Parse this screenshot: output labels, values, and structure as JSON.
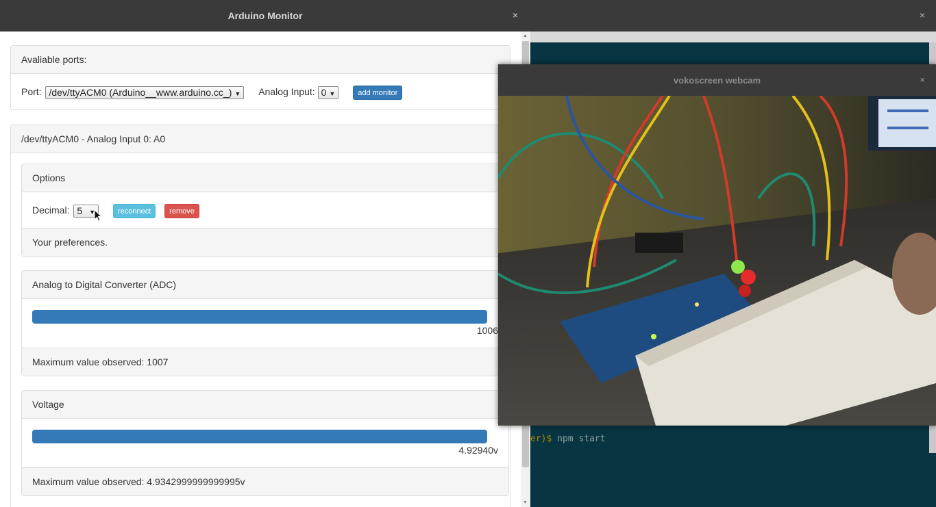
{
  "terminal": {
    "close_glyph": "×",
    "prompt_fragment": "er)$",
    "command": " npm start"
  },
  "app": {
    "title": "Arduino Monitor",
    "close_glyph": "×",
    "ports_panel": {
      "heading": "Avaliable ports:",
      "port_label": "Port:",
      "port_value": "/dev/ttyACM0 (Arduino__www.arduino.cc_)",
      "analog_label": "Analog Input:",
      "analog_value": "0",
      "add_button": "add monitor"
    },
    "monitor": {
      "heading": "/dev/ttyACM0 - Analog Input 0: A0",
      "options": {
        "heading": "Options",
        "decimal_label": "Decimal:",
        "decimal_value": "5",
        "reconnect_button": "reconnect",
        "remove_button": "remove",
        "footer": "Your preferences."
      },
      "adc": {
        "heading": "Analog to Digital Converter (ADC)",
        "value_label": "1006",
        "fill_percent": 100,
        "footer": "Maximum value observed: 1007"
      },
      "voltage": {
        "heading": "Voltage",
        "value_label": "4.92940v",
        "fill_percent": 100,
        "footer": "Maximum value observed: 4.9342999999999995v"
      }
    }
  },
  "webcam": {
    "title": "vokoscreen webcam",
    "close_glyph": "×"
  },
  "colors": {
    "primary": "#337ab7",
    "info": "#5bc0de",
    "danger": "#d9534f",
    "terminal_bg": "#073642",
    "titlebar": "#3a3a3a"
  }
}
